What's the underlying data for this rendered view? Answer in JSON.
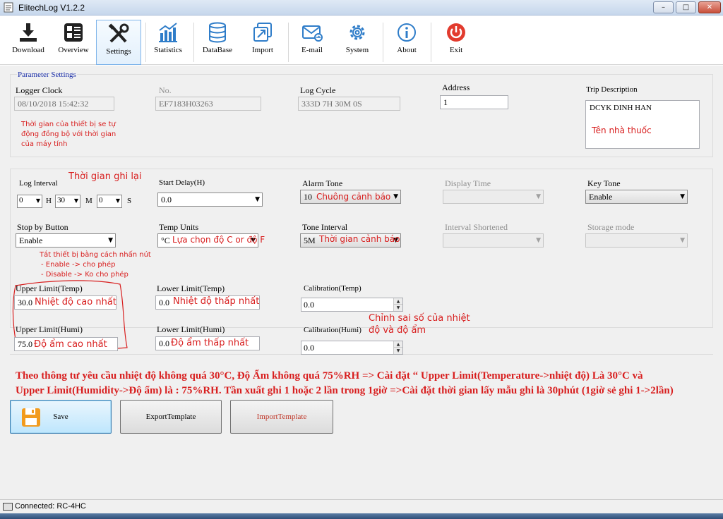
{
  "window": {
    "title": "ElitechLog V1.2.2",
    "min": "–",
    "max": "□",
    "close": "✕"
  },
  "toolbar": [
    {
      "label": "Download",
      "icon": "download-icon"
    },
    {
      "label": "Overview",
      "icon": "overview-icon"
    },
    {
      "label": "Settings",
      "icon": "settings-icon"
    },
    {
      "label": "Statistics",
      "icon": "statistics-icon"
    },
    {
      "label": "DataBase",
      "icon": "database-icon"
    },
    {
      "label": "Import",
      "icon": "import-icon"
    },
    {
      "label": "E-mail",
      "icon": "email-icon"
    },
    {
      "label": "System",
      "icon": "system-icon"
    },
    {
      "label": "About",
      "icon": "about-icon"
    },
    {
      "label": "Exit",
      "icon": "exit-icon"
    }
  ],
  "params": {
    "legend": "Parameter Settings",
    "logger_clock_label": "Logger Clock",
    "logger_clock_value": "08/10/2018 15:42:32",
    "no_label": "No.",
    "no_value": "EF7183H03263",
    "log_cycle_label": "Log Cycle",
    "log_cycle_value": "333D 7H 30M 0S",
    "address_label": "Address",
    "address_value": "1",
    "trip_label": "Trip Description",
    "trip_value": "DCYK DINH HAN"
  },
  "settings": {
    "log_interval_label": "Log Interval",
    "log_interval_h": "0",
    "log_interval_m": "30",
    "log_interval_s": "0",
    "unit_h": "H",
    "unit_m": "M",
    "unit_s": "S",
    "start_delay_label": "Start Delay(H)",
    "start_delay_value": "0.0",
    "alarm_tone_label": "Alarm Tone",
    "alarm_tone_value": "10",
    "display_time_label": "Display Time",
    "key_tone_label": "Key Tone",
    "key_tone_value": "Enable",
    "stop_by_button_label": "Stop by Button",
    "stop_by_button_value": "Enable",
    "temp_units_label": "Temp Units",
    "temp_units_value": "°C",
    "tone_interval_label": "Tone Interval",
    "tone_interval_value": "5M",
    "interval_shortened_label": "Interval Shortened",
    "storage_mode_label": "Storage mode"
  },
  "limits": {
    "upper_temp_label": "Upper Limit(Temp)",
    "upper_temp_value": "30.0",
    "lower_temp_label": "Lower Limit(Temp)",
    "lower_temp_value": "0.0",
    "cal_temp_label": "Calibration(Temp)",
    "cal_temp_value": "0.0",
    "upper_humi_label": "Upper Limit(Humi)",
    "upper_humi_value": "75.0",
    "lower_humi_label": "Lower Limit(Humi)",
    "lower_humi_value": "0.0",
    "cal_humi_label": "Calibration(Humi)",
    "cal_humi_value": "0.0"
  },
  "annotations": {
    "clock_note_1": "Thời gian của thiết bị se tự",
    "clock_note_2": "động đồng bộ với thời gian",
    "clock_note_3": "của máy tính",
    "trip_note": "Tên nhà thuốc",
    "interval_note": "Thời gian ghi lại",
    "alarm_note": "Chuông cảnh báo",
    "temp_units_note": "Lựa chọn độ C or độ F",
    "tone_interval_note": "Thời gian cảnh báo",
    "stop_note_1": "Tắt thiết bị bằng cách nhấn nút",
    "stop_note_2": "- Enable -> cho phép",
    "stop_note_3": "- Disable -> Ko cho phép",
    "upper_temp_note": "Nhiệt độ cao nhất",
    "lower_temp_note": "Nhiệt độ thấp nhất",
    "upper_humi_note": "Độ ẩm cao nhất",
    "lower_humi_note": "Độ ẩm thấp nhất",
    "cal_note_1": "Chỉnh sai số của nhiệt",
    "cal_note_2": "độ và độ ẩm",
    "big_note_1": "Theo thông tư yêu cầu nhiệt độ không quá 30°C, Độ Ẩm không quá 75%RH => Cài đặt “ Upper Limit(Temperature->nhiệt độ) Là 30°C và",
    "big_note_2": "Upper Limit(Humidity->Độ ẩm) là : 75%RH. Tần xuất ghi 1 hoặc 2 lần trong 1giờ =>Cài đặt thời gian lấy mẫu ghi là 30phút (1giờ sẻ ghi 1->2lần)"
  },
  "buttons": {
    "save": "Save",
    "export": "ExportTemplate",
    "import": "ImportTemplate"
  },
  "status": {
    "text": "Connected: RC-4HC"
  },
  "colors": {
    "annotation": "#d81e1e",
    "legend": "#1a2ea8",
    "import_text": "#c0392b"
  }
}
